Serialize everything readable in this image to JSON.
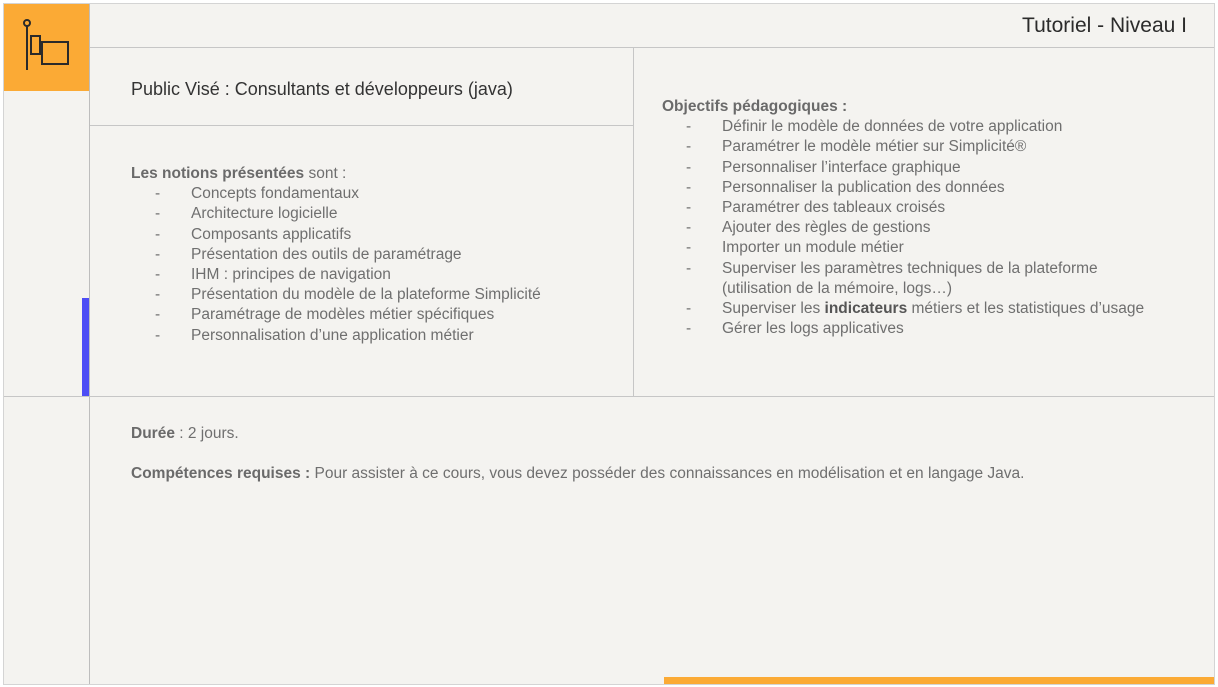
{
  "header": {
    "title": "Tutoriel - Niveau I"
  },
  "logo": {
    "icon": "flag-icon",
    "color": "#fbaa35"
  },
  "public": {
    "text": "Public Visé : Consultants et développeurs (java)"
  },
  "notions": {
    "label_bold": "Les notions présentées",
    "label_rest": " sont :",
    "items": [
      "Concepts fondamentaux",
      "Architecture logicielle",
      "Composants applicatifs",
      "Présentation des outils de paramétrage",
      "IHM : principes de navigation",
      "Présentation du modèle de la plateforme Simplicité",
      "Paramétrage de modèles métier spécifiques",
      "Personnalisation d’une application métier"
    ]
  },
  "objectifs": {
    "label_bold": "Objectifs pédagogiques :",
    "items": [
      "Définir le modèle de données de votre application",
      "Paramétrer le modèle métier sur Simplicité®",
      "Personnaliser l’interface graphique",
      "Personnaliser la publication des données",
      "Paramétrer des tableaux croisés",
      "Ajouter des règles de gestions",
      "Importer un module métier"
    ],
    "item_superviser_params": {
      "line1": "Superviser les paramètres techniques de la plateforme",
      "line2": "(utilisation de la mémoire, logs…)"
    },
    "item_indicateurs": {
      "before": "Superviser les ",
      "bold": "indicateurs",
      "after": " métiers et les statistiques d’usage"
    },
    "item_last": "Gérer les logs applicatives",
    "dash": "-"
  },
  "duree": {
    "label_bold": "Durée",
    "value": " : 2 jours."
  },
  "competences": {
    "label_bold": "Compétences requises :",
    "value": " Pour assister à ce cours, vous devez  posséder des connaissances en modélisation et en langage Java."
  },
  "colors": {
    "accent_orange": "#fbaa35",
    "accent_blue": "#4d4df5",
    "background": "#f4f3f0"
  }
}
